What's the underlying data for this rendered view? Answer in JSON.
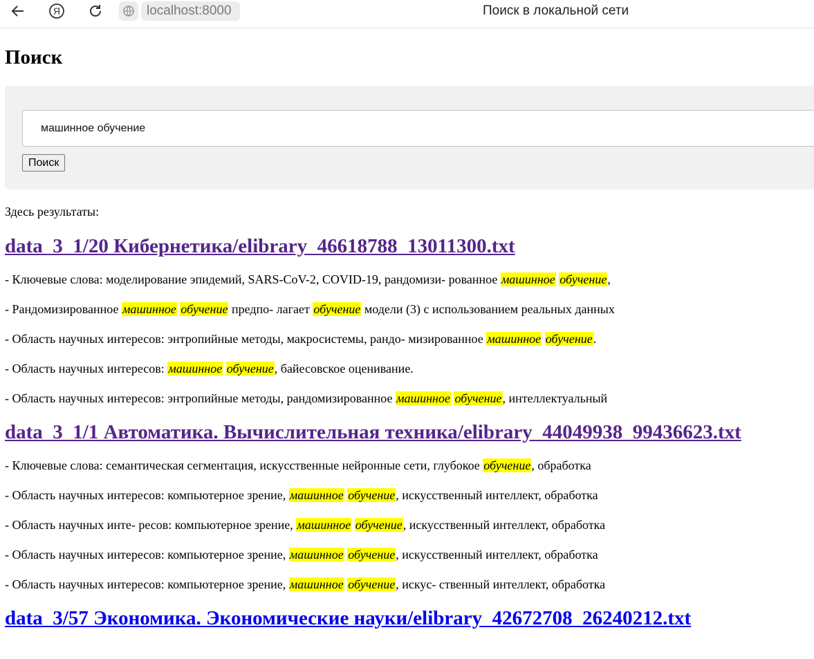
{
  "browser": {
    "url": "localhost:8000",
    "tab_title": "Поиск в локальной сети"
  },
  "page": {
    "heading": "Поиск",
    "search": {
      "value": "машинное обучение",
      "button_label": "Поиск"
    },
    "results_label": "Здесь результаты:"
  },
  "results": [
    {
      "title": "data_3_1/20 Кибернетика/elibrary_46618788_13011300.txt",
      "visited": true,
      "snippets": [
        [
          [
            "- Ключевые слова: моделирование эпидемий, SARS-CoV-2, COVID-19, рандомизи- рованное ",
            false
          ],
          [
            "машинное",
            true
          ],
          [
            " ",
            false
          ],
          [
            "обучение",
            true
          ],
          [
            ",",
            false
          ]
        ],
        [
          [
            "- Рандомизированное ",
            false
          ],
          [
            "машинное",
            true
          ],
          [
            " ",
            false
          ],
          [
            "обучение",
            true
          ],
          [
            " предпо- лагает ",
            false
          ],
          [
            "обучение",
            true
          ],
          [
            " модели (3) с использованием реальных данных",
            false
          ]
        ],
        [
          [
            "- Область научных интересов: энтропийные методы, макросистемы, рандо- мизированное ",
            false
          ],
          [
            "машинное",
            true
          ],
          [
            " ",
            false
          ],
          [
            "обучение",
            true
          ],
          [
            ".",
            false
          ]
        ],
        [
          [
            "- Область научных интересов: ",
            false
          ],
          [
            "машинное",
            true
          ],
          [
            " ",
            false
          ],
          [
            "обучение",
            true
          ],
          [
            ", байесовское оценивание.",
            false
          ]
        ],
        [
          [
            "- Область научных интересов: энтропийные методы, рандомизированное ",
            false
          ],
          [
            "машинное",
            true
          ],
          [
            " ",
            false
          ],
          [
            "обучение",
            true
          ],
          [
            ", интеллектуальный",
            false
          ]
        ]
      ]
    },
    {
      "title": "data_3_1/1 Автоматика. Вычислительная техника/elibrary_44049938_99436623.txt",
      "visited": true,
      "snippets": [
        [
          [
            "- Ключевые слова: семантическая сегментация, искусственные нейронные сети, глубокое ",
            false
          ],
          [
            "обучение",
            true
          ],
          [
            ", обработка",
            false
          ]
        ],
        [
          [
            "- Область научных интересов: компьютерное зрение, ",
            false
          ],
          [
            "машинное",
            true
          ],
          [
            " ",
            false
          ],
          [
            "обучение",
            true
          ],
          [
            ", искусственный интеллект, обработка",
            false
          ]
        ],
        [
          [
            "- Область научных инте- ресов: компьютерное зрение, ",
            false
          ],
          [
            "машинное",
            true
          ],
          [
            " ",
            false
          ],
          [
            "обучение",
            true
          ],
          [
            ", искусственный интеллект, обработка",
            false
          ]
        ],
        [
          [
            "- Область научных интересов: компьютерное зрение, ",
            false
          ],
          [
            "машинное",
            true
          ],
          [
            " ",
            false
          ],
          [
            "обучение",
            true
          ],
          [
            ", искусственный интеллект, обработка",
            false
          ]
        ],
        [
          [
            "- Область научных интересов: компьютерное зрение, ",
            false
          ],
          [
            "машинное",
            true
          ],
          [
            " ",
            false
          ],
          [
            "обучение",
            true
          ],
          [
            ", искус- ственный интеллект, обработка",
            false
          ]
        ]
      ]
    },
    {
      "title": "data_3/57 Экономика. Экономические науки/elibrary_42672708_26240212.txt",
      "visited": false,
      "snippets": []
    }
  ]
}
